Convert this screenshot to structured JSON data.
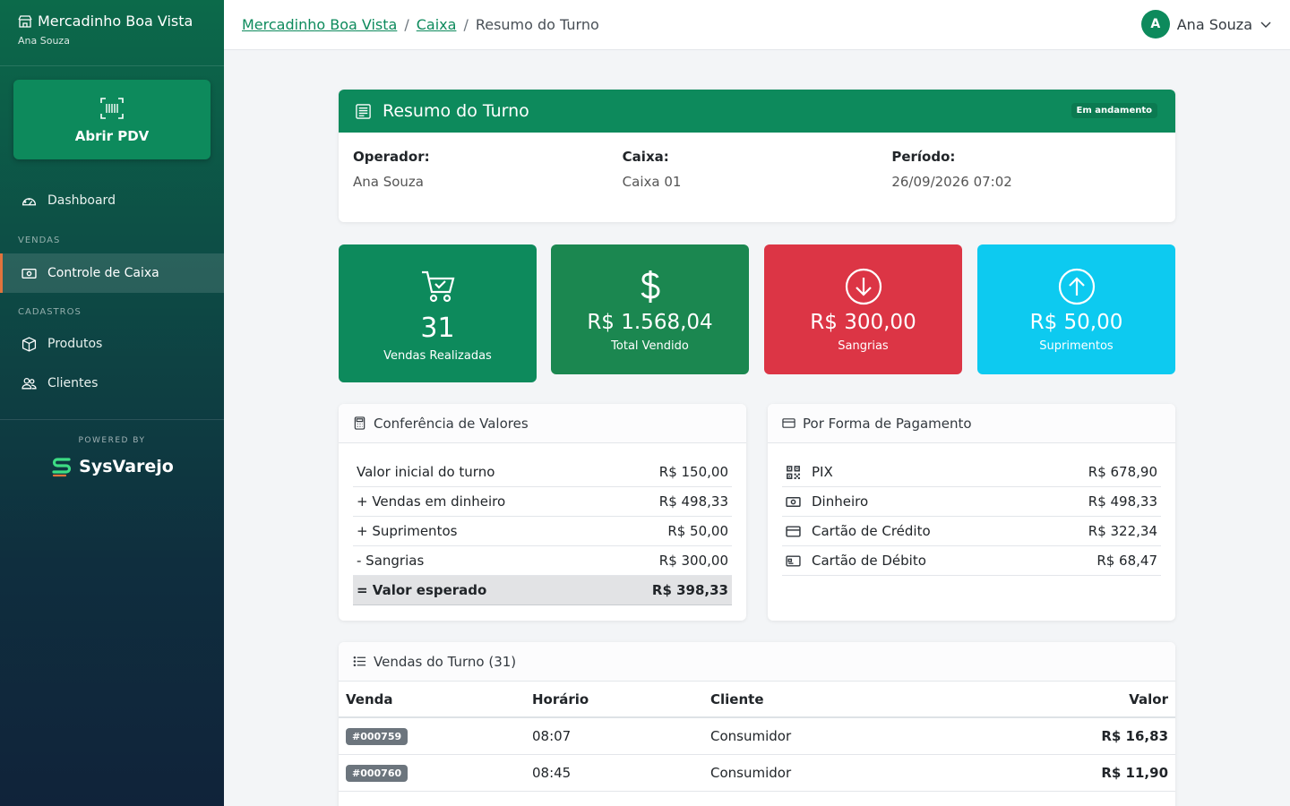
{
  "sidebar": {
    "store_name": "Mercadinho Boa Vista",
    "user_name": "Ana Souza",
    "pdv_label": "Abrir PDV",
    "items": [
      {
        "label": "Dashboard"
      },
      {
        "label": "Controle de Caixa"
      },
      {
        "label": "Produtos"
      },
      {
        "label": "Clientes"
      }
    ],
    "section_sales": "VENDAS",
    "section_registry": "CADASTROS",
    "powered_by": "POWERED BY",
    "logo_text": "SysVarejo"
  },
  "topbar": {
    "breadcrumb": [
      "Mercadinho Boa Vista",
      "Caixa",
      "Resumo do Turno"
    ],
    "separator": "/",
    "avatar_letter": "A",
    "user_name": "Ana Souza"
  },
  "summary": {
    "title": "Resumo do Turno",
    "status": "Em andamento",
    "operator_label": "Operador:",
    "operator_value": "Ana Souza",
    "register_label": "Caixa:",
    "register_value": "Caixa 01",
    "period_label": "Período:",
    "period_value": "26/09/2026 07:02"
  },
  "stats": [
    {
      "value": "31",
      "caption": "Vendas Realizadas"
    },
    {
      "value": "R$ 1.568,04",
      "caption": "Total Vendido"
    },
    {
      "value": "R$ 300,00",
      "caption": "Sangrias"
    },
    {
      "value": "R$ 50,00",
      "caption": "Suprimentos"
    }
  ],
  "conference": {
    "title": "Conferência de Valores",
    "rows": [
      {
        "label": "Valor inicial do turno",
        "value": "R$ 150,00"
      },
      {
        "label": "+ Vendas em dinheiro",
        "value": "R$ 498,33"
      },
      {
        "label": "+ Suprimentos",
        "value": "R$ 50,00"
      },
      {
        "label": "- Sangrias",
        "value": "R$ 300,00"
      },
      {
        "label": "= Valor esperado",
        "value": "R$ 398,33"
      }
    ]
  },
  "payments": {
    "title": "Por Forma de Pagamento",
    "rows": [
      {
        "label": "PIX",
        "value": "R$ 678,90",
        "icon": "qr-code-icon"
      },
      {
        "label": "Dinheiro",
        "value": "R$ 498,33",
        "icon": "cash-icon"
      },
      {
        "label": "Cartão de Crédito",
        "value": "R$ 322,34",
        "icon": "credit-card-icon"
      },
      {
        "label": "Cartão de Débito",
        "value": "R$ 68,47",
        "icon": "debit-card-icon"
      }
    ]
  },
  "sales": {
    "title": "Vendas do Turno (31)",
    "columns": [
      "Venda",
      "Horário",
      "Cliente",
      "Valor"
    ],
    "rows": [
      {
        "id": "#000759",
        "time": "08:07",
        "client": "Consumidor",
        "value": "R$ 16,83"
      },
      {
        "id": "#000760",
        "time": "08:45",
        "client": "Consumidor",
        "value": "R$ 11,90"
      }
    ]
  },
  "colors": {
    "primary": "#0d8a5c",
    "danger": "#dc3545",
    "info": "#0dcaf0",
    "accent": "#e1733c"
  }
}
